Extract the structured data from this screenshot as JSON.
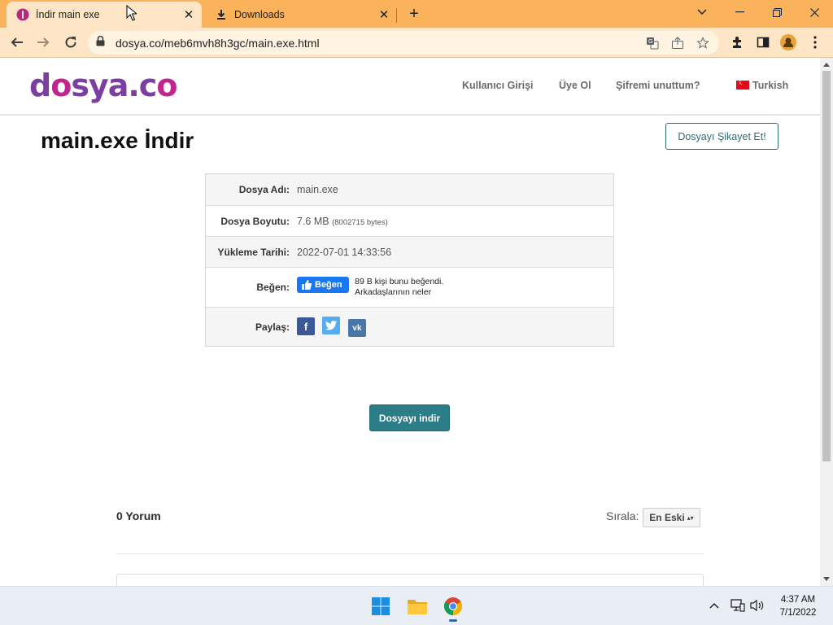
{
  "browser": {
    "tabs": [
      {
        "title": "İndir main exe",
        "active": true
      },
      {
        "title": "Downloads",
        "active": false
      }
    ],
    "url": "dosya.co/meb6mvh8h3gc/main.exe.html",
    "accent": "#fbb35b"
  },
  "site": {
    "logo_left": "d",
    "logo_o": "o",
    "logo_mid": "sya.c",
    "logo_o2": "o",
    "nav": [
      "Kullanıcı Girişi",
      "Üye Ol",
      "Şifremi unuttum?"
    ],
    "language": "Turkish"
  },
  "main": {
    "title": "main.exe İndir",
    "report_label": "Dosyayı Şikayet Et!",
    "fields": [
      {
        "key": "Dosya Adı:",
        "value": "main.exe"
      },
      {
        "key": "Dosya Boyutu:",
        "value": "7.6 MB",
        "extra": "(8002715 bytes)"
      },
      {
        "key": "Yükleme Tarihi:",
        "value": "2022-07-01 14:33:56"
      },
      {
        "key": "Beğen:"
      },
      {
        "key": "Paylaş:"
      }
    ],
    "like_button": "Beğen",
    "like_text_1": "89 B kişi bunu beğendi.",
    "like_text_2": "Arkadaşlarının neler",
    "share_icons": [
      "facebook-icon",
      "twitter-icon",
      "vk-icon"
    ],
    "download_label": "Dosyayı indir"
  },
  "comments": {
    "count_label": "0 Yorum",
    "sort_label": "Sırala:",
    "sort_value": "En Eski"
  },
  "taskbar": {
    "time": "4:37 AM",
    "date": "7/1/2022"
  }
}
